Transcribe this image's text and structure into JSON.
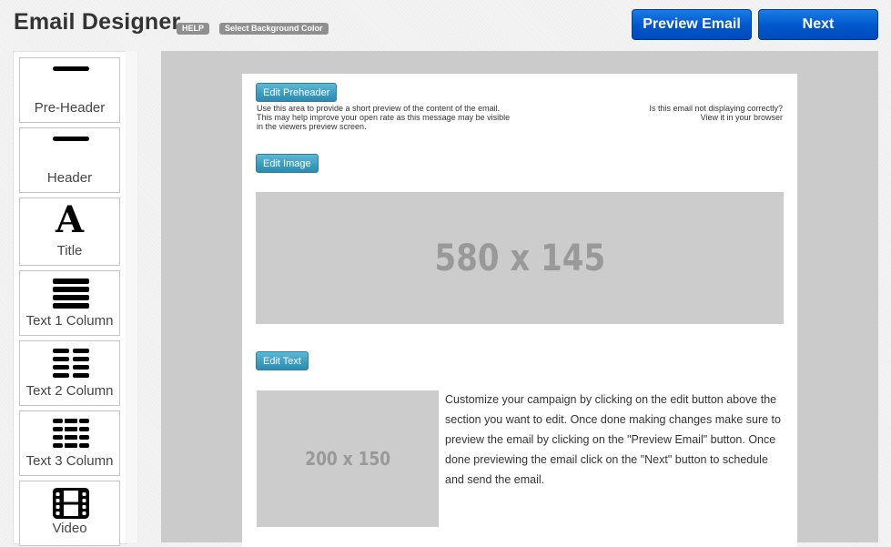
{
  "header": {
    "title": "Email Designer",
    "help_label": "HELP",
    "bg_color_label": "Select Background Color",
    "preview_label": "Preview Email",
    "next_label": "Next"
  },
  "sidebar": {
    "items": [
      {
        "label": "Pre-Header",
        "icon": "pre-header-icon"
      },
      {
        "label": "Header",
        "icon": "header-icon"
      },
      {
        "label": "Title",
        "icon": "title-letter-a-icon"
      },
      {
        "label": "Text 1 Column",
        "icon": "text-1-column-icon"
      },
      {
        "label": "Text 2 Column",
        "icon": "text-2-column-icon"
      },
      {
        "label": "Text 3 Column",
        "icon": "text-3-column-icon"
      },
      {
        "label": "Video",
        "icon": "film-icon"
      }
    ]
  },
  "email": {
    "edit_preheader_label": "Edit Preheader",
    "preheader_text": "Use this area to provide a short preview of the content of the email. This may help improve your open rate as this message may be visible in the viewers preview screen.",
    "not_displaying_text": "Is this email not displaying correctly?",
    "view_in_browser_text": "View it in your browser",
    "edit_image_label": "Edit Image",
    "banner_placeholder": "580 x 145",
    "edit_text_label": "Edit Text",
    "side_image_placeholder": "200 x 150",
    "body_text": "Customize your campaign by clicking on the edit button above the section you want to edit. Once done making changes make sure to preview the email by clicking on the \"Preview Email\" button. Once done previewing the email click on the \"Next\" button to schedule and send the email."
  }
}
